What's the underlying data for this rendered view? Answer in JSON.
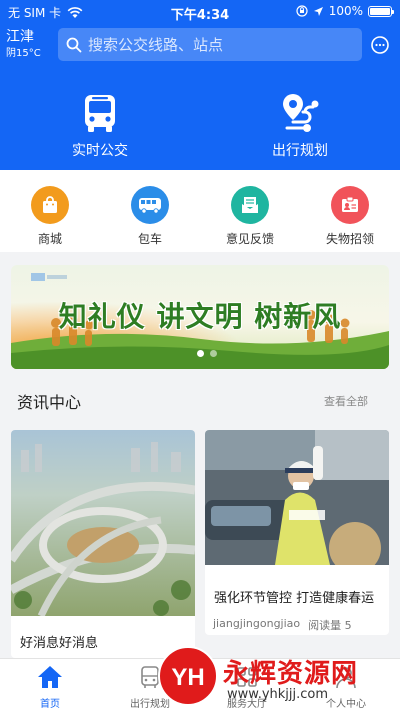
{
  "status_bar": {
    "carrier": "无 SIM 卡",
    "time": "下午4:34",
    "battery": "100%",
    "battery_level": 1.0
  },
  "header": {
    "city": "江津",
    "weather": "阴15°C",
    "search": {
      "placeholder": "搜索公交线路、站点"
    },
    "message_icon": "chat-bubble-icon",
    "hero_items": [
      {
        "label": "实时公交",
        "icon": "bus-front-icon"
      },
      {
        "label": "出行规划",
        "icon": "route-pin-icon"
      }
    ]
  },
  "quick_services": [
    {
      "label": "商城",
      "icon": "shopping-bag-icon",
      "color": "#f29b1d"
    },
    {
      "label": "包车",
      "icon": "coach-bus-icon",
      "color": "#2b8de8"
    },
    {
      "label": "意见反馈",
      "icon": "mail-icon",
      "color": "#1fb5a0"
    },
    {
      "label": "失物招领",
      "icon": "id-card-icon",
      "color": "#f1535a"
    }
  ],
  "banner": {
    "text": "知礼仪 讲文明 树新风",
    "slide_count": 2,
    "active_slide": 1
  },
  "news": {
    "section_title": "资讯中心",
    "view_all": "查看全部",
    "items": [
      {
        "title": "好消息好消息",
        "image": "highway-interchange-photo"
      },
      {
        "title": "强化环节管控 打造健康春运",
        "author": "jiangjingongjiao",
        "read_count_label": "阅读量",
        "read_count": "5",
        "image": "traffic-police-photo"
      }
    ]
  },
  "tab_bar": [
    {
      "label": "首页",
      "icon": "home-icon",
      "active": true
    },
    {
      "label": "出行规划",
      "icon": "bus-outline-icon",
      "active": false
    },
    {
      "label": "服务大厅",
      "icon": "grid-icon",
      "active": false
    },
    {
      "label": "个人中心",
      "icon": "person-icon",
      "active": false
    }
  ],
  "colors": {
    "primary": "#1466f5",
    "page_bg": "#f2f3f5",
    "banner_text": "#2e7d23",
    "watermark_red": "#e01b1b"
  },
  "watermark": {
    "logo_text": "YH",
    "name": "永辉资源网",
    "url": "www.yhkjjj.com"
  }
}
